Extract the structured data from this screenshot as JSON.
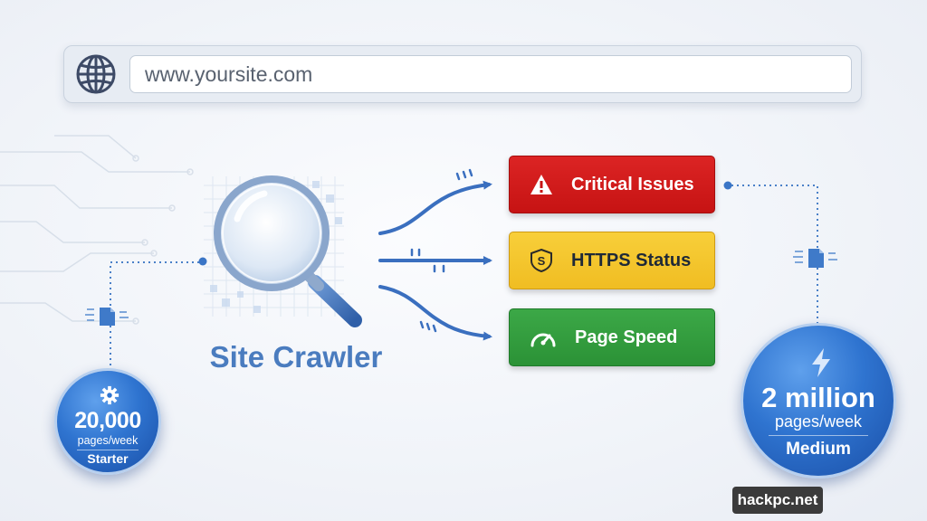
{
  "url_bar": {
    "url": "www.yoursite.com",
    "icon": "globe-icon"
  },
  "crawler": {
    "label": "Site Crawler",
    "icon": "magnifier-icon"
  },
  "checks": [
    {
      "label": "Critical Issues",
      "icon": "warning-icon",
      "color": "#d61c1c"
    },
    {
      "label": "HTTPS Status",
      "icon": "shield-icon",
      "color": "#f5c531"
    },
    {
      "label": "Page Speed",
      "icon": "gauge-icon",
      "color": "#35a040"
    }
  ],
  "plans": {
    "starter": {
      "value": "20,000",
      "unit": "pages/week",
      "name": "Starter",
      "icon": "gear-icon"
    },
    "medium": {
      "value": "2 million",
      "unit": "pages/week",
      "name": "Medium",
      "icon": "lightning-icon"
    }
  },
  "colors": {
    "accent": "#2f74d0",
    "crawler_text": "#4a7cbf",
    "arrow": "#3a6fbf"
  },
  "watermark": "hackpc.net"
}
